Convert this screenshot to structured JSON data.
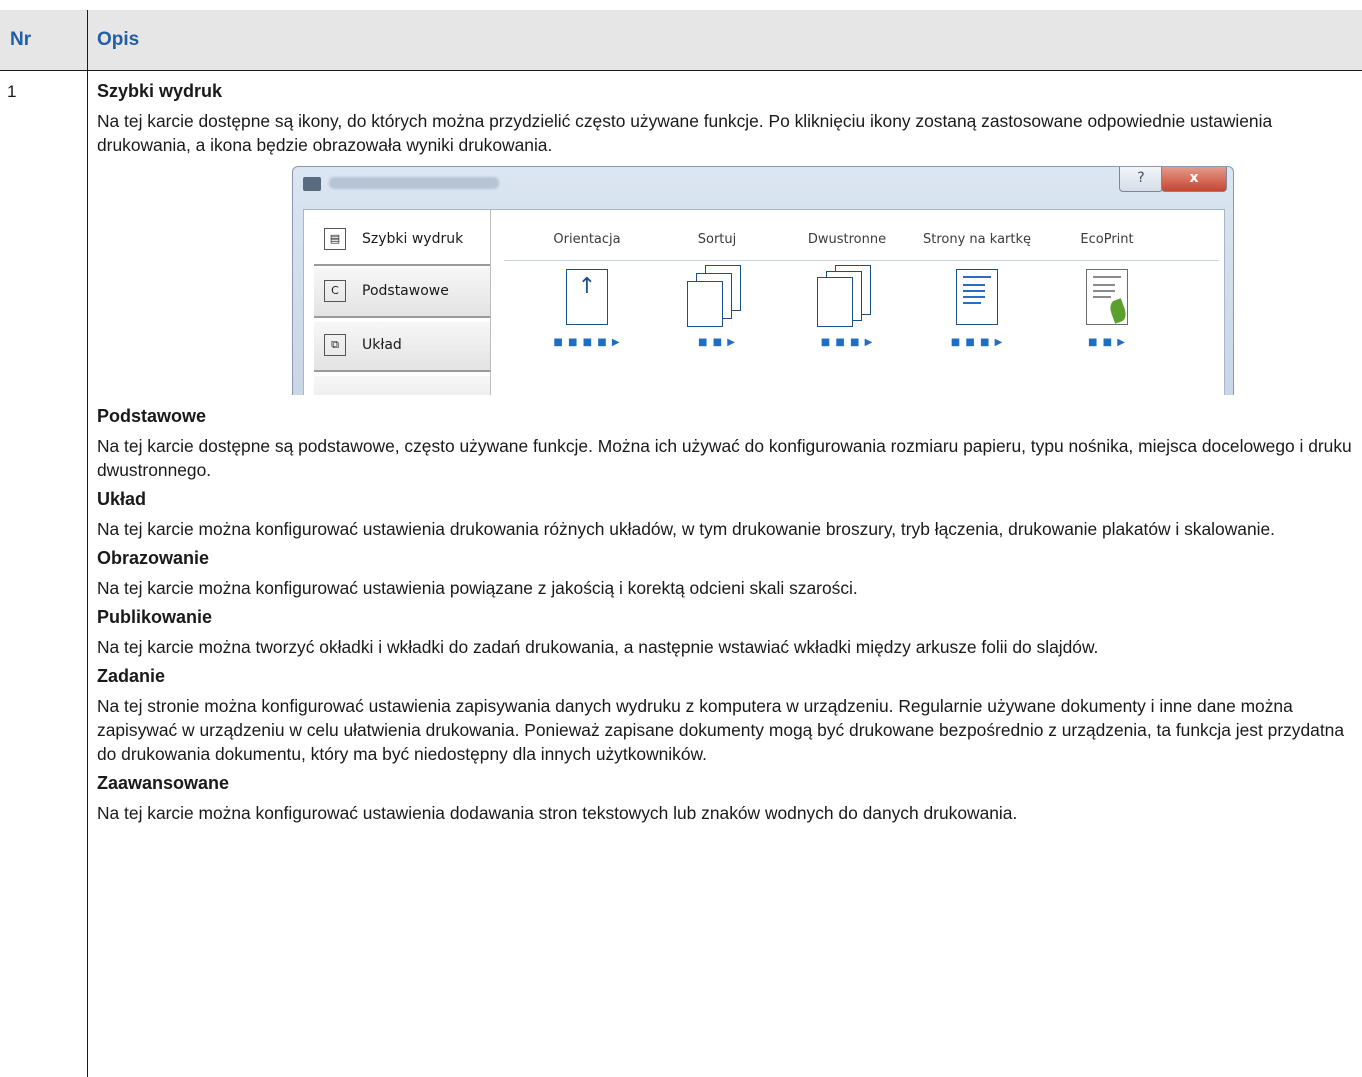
{
  "header": {
    "nr": "Nr",
    "opis": "Opis"
  },
  "row": {
    "nr": "1",
    "sections": [
      {
        "title": "Szybki wydruk",
        "text": "Na tej karcie dostępne są ikony, do których można przydzielić często używane funkcje. Po kliknięciu ikony zostaną zastosowane odpowiednie ustawienia drukowania, a ikona będzie obrazowała wyniki drukowania."
      },
      {
        "title": "Podstawowe",
        "text": "Na tej karcie dostępne są podstawowe, często używane funkcje. Można ich używać do konfigurowania rozmiaru papieru, typu nośnika, miejsca docelowego i druku dwustronnego."
      },
      {
        "title": "Układ",
        "text": "Na tej karcie można konfigurować ustawienia drukowania różnych układów, w tym drukowanie broszury, tryb łączenia, drukowanie plakatów i skalowanie."
      },
      {
        "title": "Obrazowanie",
        "text": "Na tej karcie można konfigurować ustawienia powiązane z jakością i korektą odcieni skali szarości."
      },
      {
        "title": "Publikowanie",
        "text": "Na tej karcie można tworzyć okładki i wkładki do zadań drukowania, a następnie wstawiać wkładki między arkusze folii do slajdów."
      },
      {
        "title": "Zadanie",
        "text": "Na tej stronie można konfigurować ustawienia zapisywania danych wydruku z komputera w urządzeniu. Regularnie używane dokumenty i inne dane można zapisywać w urządzeniu w celu ułatwienia drukowania. Ponieważ zapisane dokumenty mogą być drukowane bezpośrednio z urządzenia, ta funkcja jest przydatna do drukowania dokumentu, który ma być niedostępny dla innych użytkowników."
      },
      {
        "title": "Zaawansowane",
        "text": "Na tej karcie można konfigurować ustawienia dodawania stron tekstowych lub znaków wodnych do danych drukowania."
      }
    ]
  },
  "dialog": {
    "help_label": "?",
    "close_label": "x",
    "tabs": [
      "Szybki wydruk",
      "Podstawowe",
      "Układ"
    ],
    "options": [
      "Orientacja",
      "Sortuj",
      "Dwustronne",
      "Strony na kartkę",
      "EcoPrint"
    ],
    "icons": {
      "printer": "printer-icon",
      "quick": "quick-print-icon",
      "basic": "basic-icon",
      "layout": "layout-icon"
    }
  }
}
